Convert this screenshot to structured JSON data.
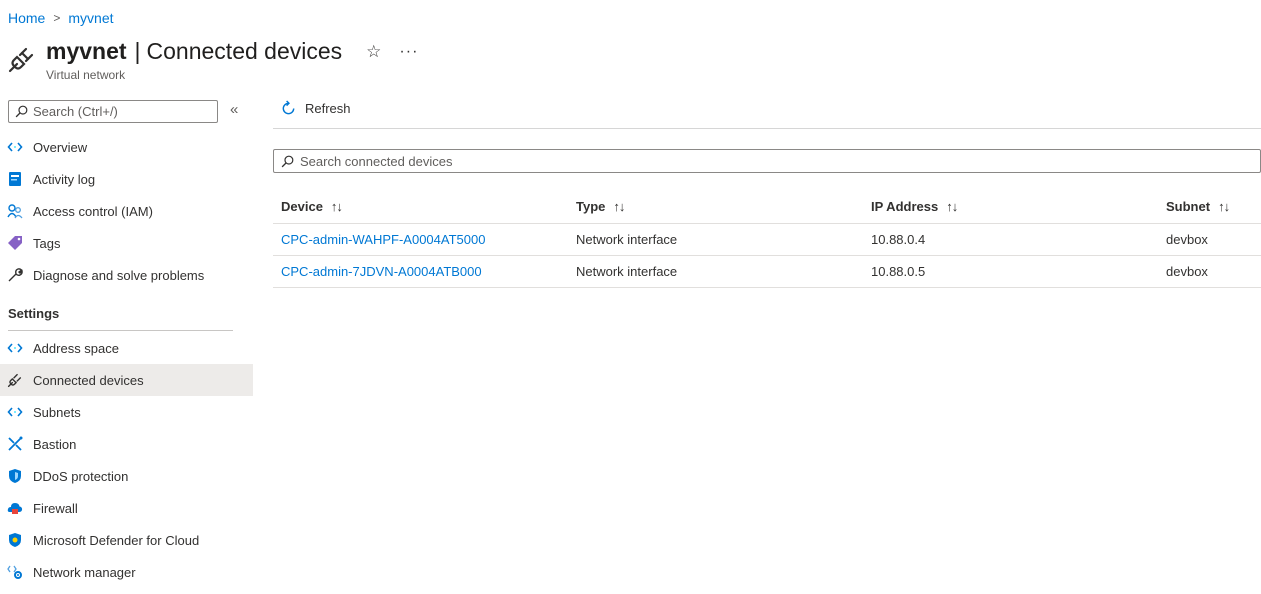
{
  "breadcrumb": {
    "home": "Home",
    "separator": ">",
    "current": "myvnet"
  },
  "header": {
    "resource_name": "myvnet",
    "divider": "|",
    "page_title": "Connected devices",
    "subtitle": "Virtual network",
    "favorite_icon": "star-icon",
    "more_label": "···"
  },
  "sidebar": {
    "search_placeholder": "Search (Ctrl+/)",
    "collapse_label": "«",
    "items_top": [
      {
        "label": "Overview",
        "icon": "overview-icon"
      },
      {
        "label": "Activity log",
        "icon": "activity-log-icon"
      },
      {
        "label": "Access control (IAM)",
        "icon": "iam-icon"
      },
      {
        "label": "Tags",
        "icon": "tag-icon"
      },
      {
        "label": "Diagnose and solve problems",
        "icon": "wrench-icon"
      }
    ],
    "settings_header": "Settings",
    "items_settings": [
      {
        "label": "Address space",
        "icon": "address-space-icon"
      },
      {
        "label": "Connected devices",
        "icon": "plug-icon",
        "active": true
      },
      {
        "label": "Subnets",
        "icon": "subnet-icon"
      },
      {
        "label": "Bastion",
        "icon": "bastion-icon"
      },
      {
        "label": "DDoS protection",
        "icon": "shield-icon"
      },
      {
        "label": "Firewall",
        "icon": "firewall-icon"
      },
      {
        "label": "Microsoft Defender for Cloud",
        "icon": "defender-icon"
      },
      {
        "label": "Network manager",
        "icon": "network-manager-icon"
      }
    ]
  },
  "toolbar": {
    "refresh_label": "Refresh"
  },
  "search": {
    "placeholder": "Search connected devices"
  },
  "table": {
    "columns": [
      "Device",
      "Type",
      "IP Address",
      "Subnet"
    ],
    "sort_glyph": "↑↓",
    "rows": [
      {
        "device": "CPC-admin-WAHPF-A0004AT5000",
        "type": "Network interface",
        "ip": "10.88.0.4",
        "subnet": "devbox"
      },
      {
        "device": "CPC-admin-7JDVN-A0004ATB000",
        "type": "Network interface",
        "ip": "10.88.0.5",
        "subnet": "devbox"
      }
    ]
  },
  "colors": {
    "accent": "#0078d4",
    "text": "#323130",
    "active_nav_bg": "#edebe9"
  }
}
